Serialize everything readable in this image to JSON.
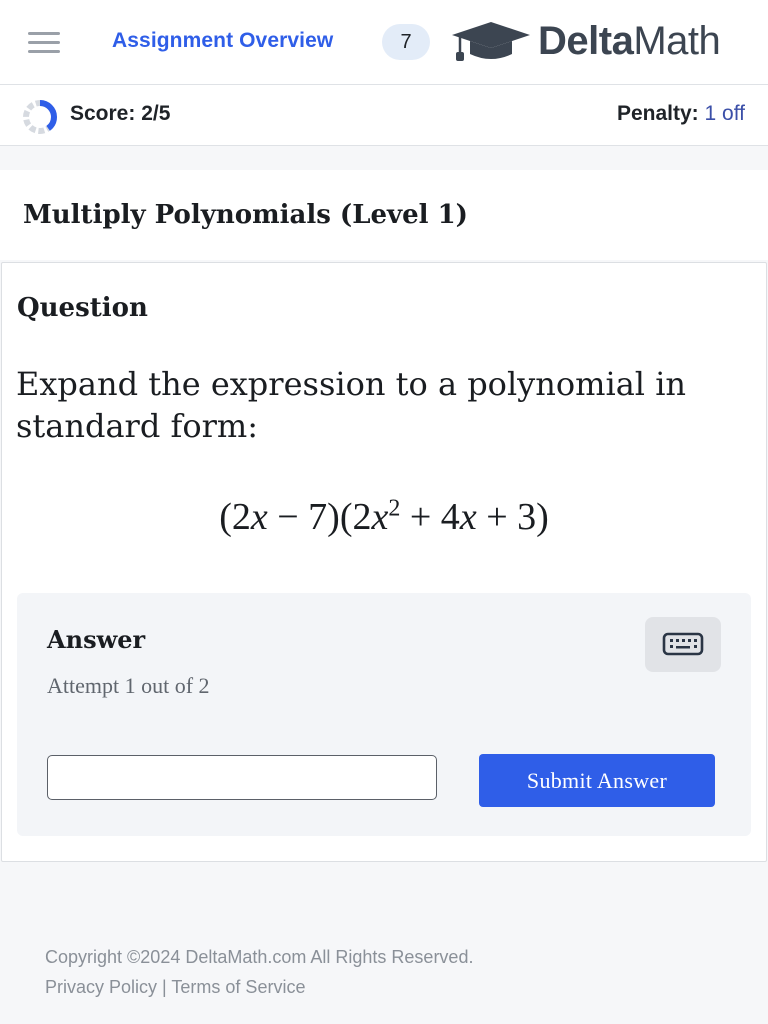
{
  "header": {
    "assignment_link": "Assignment Overview",
    "assignment_count": "7",
    "logo_bold": "Delta",
    "logo_light": "Math"
  },
  "status": {
    "score_label": "Score: 2/5",
    "penalty_label": "Penalty:",
    "penalty_value": "1 off",
    "score_progress": 0.4
  },
  "page": {
    "title": "Multiply Polynomials (Level 1)"
  },
  "question": {
    "heading": "Question",
    "prompt": "Expand the expression to a polynomial in standard form:",
    "expression": "(2x − 7)(2x² + 4x + 3)"
  },
  "answer": {
    "heading": "Answer",
    "attempt": "Attempt 1 out of 2",
    "input_value": "",
    "submit_label": "Submit Answer"
  },
  "footer": {
    "copyright": "Copyright ©2024 DeltaMath.com All Rights Reserved.",
    "privacy": "Privacy Policy",
    "separator": "|",
    "terms": "Terms of Service"
  },
  "colors": {
    "accent": "#2f5ee8",
    "background": "#f6f7f9",
    "answer_panel": "#f3f5f8"
  },
  "icons": [
    "hamburger-menu-icon",
    "graduation-cap-icon",
    "score-ring-icon",
    "keyboard-icon"
  ]
}
